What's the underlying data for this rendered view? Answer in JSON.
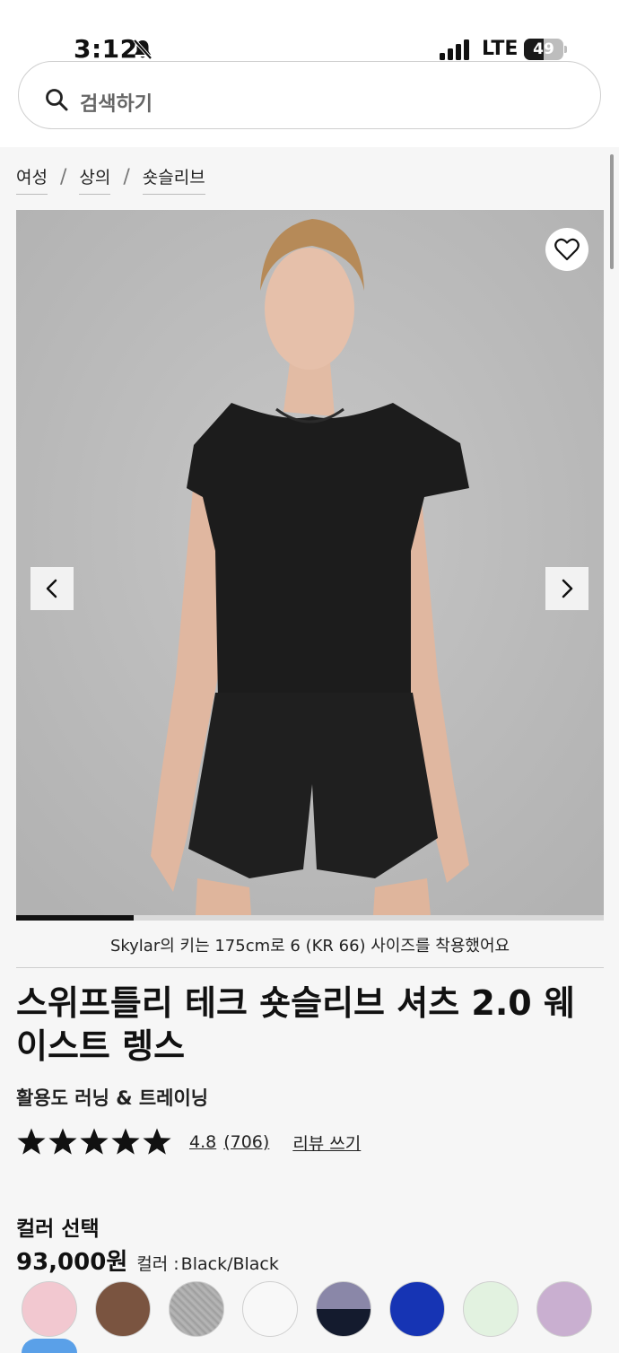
{
  "status_bar": {
    "time": "3:12",
    "network": "LTE",
    "battery_percent": "49",
    "battery_level": 0.49
  },
  "search": {
    "placeholder": "검색하기"
  },
  "breadcrumb": {
    "items": [
      "여성",
      "상의",
      "숏슬리브"
    ],
    "separator": "/"
  },
  "gallery": {
    "image_position": 1,
    "image_progress": 0.2,
    "caption": "Skylar의 키는 175cm로 6 (KR 66) 사이즈를 착용했어요"
  },
  "product": {
    "title": "스위프틀리 테크 숏슬리브 셔츠 2.0 웨이스트 렝스",
    "activity": "활용도 러닝 & 트레이닝",
    "rating": "4.8",
    "rating_count": "(706)",
    "stars_filled": 5,
    "review_link": "리뷰 쓰기",
    "color_heading": "컬러 선택",
    "price": "93,000원",
    "color_label": "컬러 :",
    "color_value": "Black/Black"
  },
  "swatches": [
    {
      "name": "pink",
      "color": "#f2c8d0"
    },
    {
      "name": "brown",
      "color": "#7a5440"
    },
    {
      "name": "heathered-grey",
      "color": "#a9a9a9"
    },
    {
      "name": "white",
      "color": "#f8f8f8"
    },
    {
      "name": "lavender-navy",
      "color": "#8a87a8",
      "color2": "#141b2e"
    },
    {
      "name": "royal-blue",
      "color": "#1634b4"
    },
    {
      "name": "mint",
      "color": "#e2f2e0"
    },
    {
      "name": "lilac",
      "color": "#c9afd0"
    }
  ],
  "colors": {
    "accent": "#111111",
    "background": "#f6f6f6",
    "image_background": "#bebebe"
  }
}
